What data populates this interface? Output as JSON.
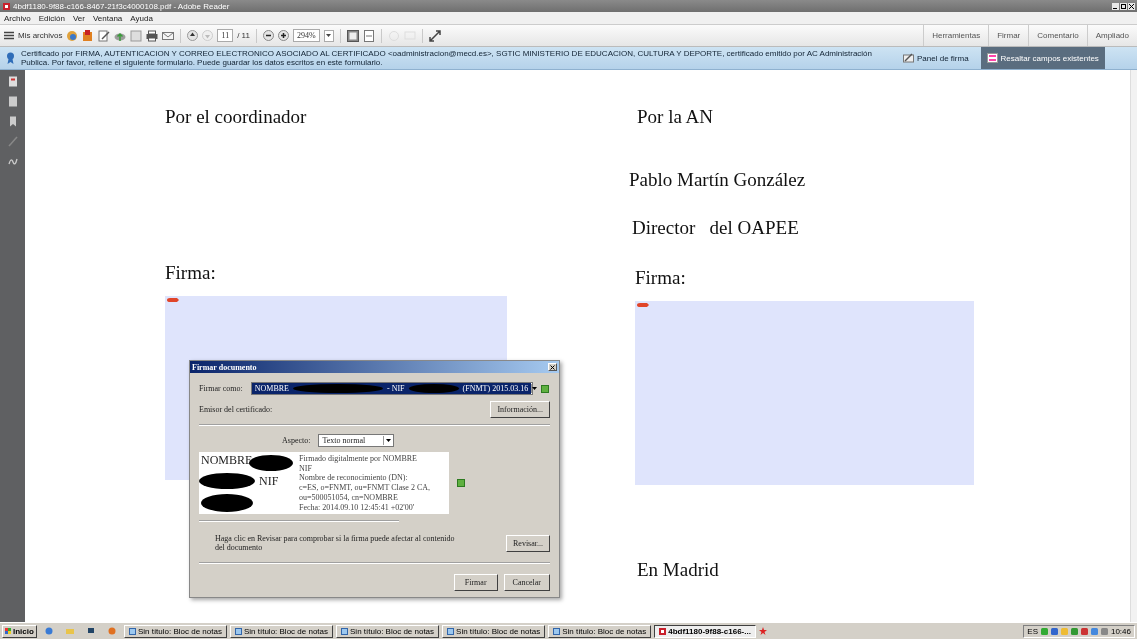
{
  "window": {
    "title": "4bdf1180-9f88-c166-8467-21f3c4000108.pdf - Adobe Reader"
  },
  "menu": [
    "Archivo",
    "Edición",
    "Ver",
    "Ventana",
    "Ayuda"
  ],
  "toolbar": {
    "my_files": "Mis archivos",
    "page": "11",
    "page_count": "/ 11",
    "zoom": "294%",
    "tabs": [
      {
        "label": "Herramientas"
      },
      {
        "label": "Firmar"
      },
      {
        "label": "Comentario"
      },
      {
        "label": "Ampliado"
      }
    ]
  },
  "info_bar": {
    "message": "Certificado por FIRMA, AUTENTICACION Y CORREO ELECTRONICO ASOCIADO AL CERTIFICADO <oadministracion@mecd.es>, SGTIC MINISTERIO DE EDUCACION, CULTURA Y DEPORTE, certificado emitido por AC Administración Publica. Por favor, rellene el siguiente formulario. Puede guardar los datos escritos en este formulario.",
    "buttons": [
      {
        "label": "Panel de firma",
        "pressed": false
      },
      {
        "label": "Resaltar campos existentes",
        "pressed": true
      }
    ]
  },
  "document": {
    "left": {
      "heading": "Por el coordinador",
      "signature_label": "Firma:"
    },
    "right": {
      "heading": "Por la AN",
      "name": "Pablo Martín González",
      "position": "Director   del OAPEE",
      "signature_label": "Firma:",
      "place": "En Madrid"
    }
  },
  "dialog": {
    "title": "Firmar documento",
    "sign_as_label": "Firmar como:",
    "sign_as_parts": [
      "NOMBRE",
      "- NIF",
      "(FNMT) 2015.03.16"
    ],
    "issuer_label": "Emisor del certificado:",
    "info_button": "Información...",
    "appearance_label": "Aspecto:",
    "appearance_value": "Texto normal",
    "preview": {
      "name": "NOMBRE",
      "nif": "NIF",
      "details": [
        "Firmado digitalmente por NOMBRE",
        "NIF",
        "Nombre de reconocimiento (DN):",
        "c=ES, o=FNMT, ou=FNMT Clase 2 CA,",
        "ou=500051054, cn=NOMBRE",
        "Fecha: 2014.09.10 12:45:41 +02'00'"
      ]
    },
    "review_text": "Haga clic en Revisar para comprobar si la firma puede afectar al contenido del documento",
    "review_button": "Revisar...",
    "sign_button": "Firmar",
    "cancel_button": "Cancelar"
  },
  "taskbar": {
    "start": "Inicio",
    "items": [
      {
        "label": "Sin título: Bloc de notas",
        "selected": false
      },
      {
        "label": "Sin título: Bloc de notas",
        "selected": false
      },
      {
        "label": "Sin título: Bloc de notas",
        "selected": false
      },
      {
        "label": "Sin título: Bloc de notas",
        "selected": false
      },
      {
        "label": "Sin título: Bloc de notas",
        "selected": false
      },
      {
        "label": "4bdf1180-9f88-c166-...",
        "selected": true
      }
    ],
    "language": "ES",
    "clock": "10:46"
  }
}
